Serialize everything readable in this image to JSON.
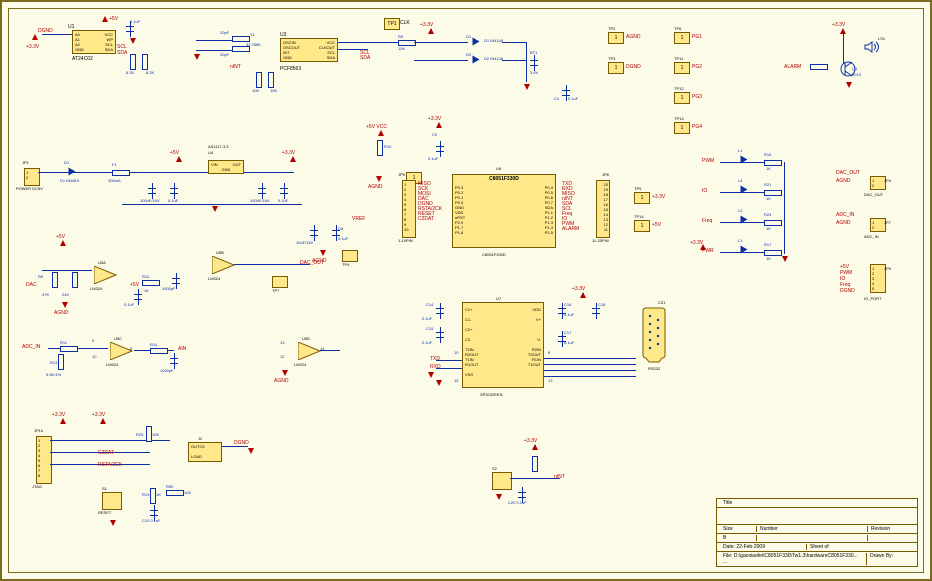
{
  "sheet": {
    "title_block": {
      "title_label": "Title",
      "title": "",
      "size_label": "Size",
      "size": "B",
      "number_label": "Number",
      "number": "",
      "rev_label": "Revision",
      "rev": "",
      "date_label": "Date:",
      "date": "22-Feb-2009",
      "sheet_label": "Sheet",
      "sheet": "of",
      "file_label": "File:",
      "file": "D:\\gaoxiaofei\\C8051F330\\Tw1.3\\hardwareC8051F330... ...",
      "drawn_label": "Drawn By:"
    }
  },
  "eeprom": {
    "ref": "U1",
    "part": "AT24C02",
    "pins": [
      "A0",
      "A1",
      "A2",
      "GND",
      "WP",
      "SCL",
      "SDA",
      "VCC"
    ],
    "pwr": "+5V",
    "gnd": "DGND",
    "nets": {
      "scl": "SCL",
      "sda": "SDA"
    },
    "decouple": {
      "ref": "C9",
      "val": "0.1uF"
    },
    "pullups": [
      {
        "ref": "R1",
        "val": "8.2K"
      },
      {
        "ref": "R2",
        "val": "8.2K"
      }
    ]
  },
  "rtc": {
    "ref": "U3",
    "part": "PCF8563",
    "pins_l": [
      "OSCIN",
      "OSCOUT",
      "INT",
      "GND"
    ],
    "pins_r": [
      "VCC",
      "CLKOUT",
      "SCL",
      "SDA"
    ],
    "crystal": {
      "ref": "Y1",
      "val": "32.768K",
      "c1": "20pF",
      "c2": "20pF"
    },
    "pullups": [
      {
        "ref": "R3",
        "val": "10K"
      },
      {
        "ref": "R4",
        "val": "10K"
      }
    ],
    "int_net": "nINT",
    "out": {
      "tp": "TP1",
      "net": "CLK",
      "r": "R5",
      "rv": "10K"
    },
    "pwr": "+3.3V",
    "diodes": [
      "D1 IN4148",
      "D2 IN4148"
    ],
    "bat": {
      "ref": "BT1",
      "val": "3.6V"
    },
    "cap": {
      "ref": "C4",
      "val": "0.1uF"
    }
  },
  "power_tp": [
    {
      "ref": "TP2",
      "net": "AGND"
    },
    {
      "ref": "TP3",
      "net": "DGND"
    }
  ],
  "scope_tp": [
    {
      "ref": "TP6",
      "net": "PG1"
    },
    {
      "ref": "TP11",
      "net": "PG2"
    },
    {
      "ref": "TP12",
      "net": "PG3"
    },
    {
      "ref": "TP13",
      "net": "PG4"
    }
  ],
  "buzzer": {
    "ref": "LS1",
    "q": "Q1 9013",
    "r1": "R30 1K",
    "net": "ALARM",
    "pwr": "+3.3V"
  },
  "power_in": {
    "conn": {
      "ref": "JP1",
      "label": "POWER DC5V",
      "pins": [
        "1",
        "2"
      ]
    },
    "diode": "D1 IN5819",
    "fuse": {
      "ref": "F1",
      "val": "300mA"
    },
    "reg": {
      "ref": "U4",
      "part": "AS1117-3.3",
      "pins": [
        "VIN",
        "OUT",
        "GND"
      ]
    },
    "caps": [
      {
        "ref": "C5",
        "val": "100uF/16V"
      },
      {
        "ref": "C6",
        "val": "0.1uF"
      },
      {
        "ref": "C7",
        "val": "100uF/16V"
      },
      {
        "ref": "C8",
        "val": "0.1uF"
      }
    ],
    "outs": [
      "+5V",
      "+3.3V"
    ]
  },
  "vref": {
    "net": "VREF",
    "r": "R10",
    "cap": {
      "ref": "C9",
      "val": "0.1uF"
    },
    "tp": "TP3?",
    "agnd": "AGND",
    "pwr": "+5V VCC"
  },
  "mcu": {
    "ref": "U6",
    "part": "C8051F330D",
    "subtitle": "C8051F330D",
    "left_header": "1-10PIN",
    "right_header": "11-20PIN",
    "pins_left": [
      {
        "n": "1",
        "net": "MISO",
        "pin": "P0.3"
      },
      {
        "n": "2",
        "net": "SCK",
        "pin": "P0.2"
      },
      {
        "n": "3",
        "net": "MOSI",
        "pin": "P0.1"
      },
      {
        "n": "4",
        "net": "DAC",
        "pin": "P0.0"
      },
      {
        "n": "5",
        "net": "DGND",
        "pin": "GND"
      },
      {
        "n": "6",
        "net": "RSTA/2CK",
        "pin": "VDD"
      },
      {
        "n": "7",
        "net": "RESET",
        "pin": "nRST"
      },
      {
        "n": "8",
        "net": "C2DAT",
        "pin": "P2.0"
      },
      {
        "n": "9",
        "net": "",
        "pin": "P1.7"
      },
      {
        "n": "10",
        "net": "",
        "pin": "P1.6"
      }
    ],
    "pins_right": [
      {
        "n": "20",
        "pin": "P0.4",
        "net": "TXD"
      },
      {
        "n": "19",
        "pin": "P0.5",
        "net": "RXD"
      },
      {
        "n": "18",
        "pin": "P0.6",
        "net": "MISO"
      },
      {
        "n": "17",
        "pin": "P0.7",
        "net": "nINT"
      },
      {
        "n": "16",
        "pin": "SDA",
        "net": "SDA"
      },
      {
        "n": "15",
        "pin": "P1.1",
        "net": "SCL"
      },
      {
        "n": "14",
        "pin": "P1.2",
        "net": "Freq"
      },
      {
        "n": "13",
        "pin": "P1.3",
        "net": "IO"
      },
      {
        "n": "12",
        "pin": "P1.4",
        "net": "PWM"
      },
      {
        "n": "11",
        "pin": "P1.5",
        "net": "ALARM"
      }
    ],
    "headers": {
      "left": "JP5",
      "right": "JP6"
    },
    "tp": [
      {
        "ref": "TP5",
        "net": "+3.3V"
      },
      {
        "ref": "TP14",
        "net": "+5V"
      }
    ]
  },
  "leds": [
    {
      "net": "PWM",
      "led": "L1",
      "r": "R15 1K"
    },
    {
      "net": "IO",
      "led": "L4",
      "r": "R21 1K"
    },
    {
      "net": "Freq",
      "led": "L2",
      "r": "R24 1K"
    },
    {
      "net": "PWR",
      "led": "L3",
      "r": "R17 1K"
    }
  ],
  "led_rail": "+3.3V",
  "io_ports": [
    {
      "ref": "JP4",
      "label": "DAC_OUT",
      "nets": [
        "AGND",
        "DAC_OUT"
      ],
      "pins": [
        "1",
        "2"
      ]
    },
    {
      "ref": "JP7",
      "label": "ADC_IN",
      "nets": [
        "AGND",
        "ADC_IN"
      ],
      "pins": [
        "1",
        "2"
      ]
    },
    {
      "ref": "JP9",
      "label": "IO_PORT",
      "nets": [
        "+5V",
        "PWM",
        "IO",
        "Freq",
        "DGND"
      ],
      "pins": [
        "1",
        "2",
        "3",
        "4",
        "5"
      ]
    }
  ],
  "analog_vref": {
    "net": "VREF",
    "cap": "C8 0.1uF",
    "cap2": "10uF/16V",
    "rail": "+3.3V",
    "tp": "TP4",
    "agnd": "AGND"
  },
  "dac_chain": {
    "u5a": {
      "ref": "U5A",
      "part": "LM324"
    },
    "u5b": {
      "ref": "U5B",
      "part": "LM324"
    },
    "in": "DAC",
    "out": "DAC_OUT",
    "r": [
      {
        "ref": "R6",
        "val": "47K"
      },
      {
        "ref": "R7",
        "val": "24K"
      },
      {
        "ref": "R12",
        "val": "1K"
      }
    ],
    "c": [
      {
        "ref": "C10",
        "val": "0.1uF"
      },
      {
        "ref": "C11",
        "val": "1000pF"
      }
    ],
    "rail": "+5V",
    "agnd": "AGND",
    "tp": "TP7"
  },
  "adc_chain": {
    "u5c": {
      "ref": "U5C",
      "part": "LM324"
    },
    "u5d": {
      "ref": "U5D",
      "part": "LM324"
    },
    "in": "ADC_IN",
    "out": "AIN",
    "r": [
      {
        "ref": "R11",
        "val": ""
      },
      {
        "ref": "R13",
        "val": "5.5K/1%"
      },
      {
        "ref": "R14",
        "val": ""
      },
      {
        "ref": "R15",
        "val": "1000pF"
      }
    ],
    "tie_out": "14"
  },
  "jtag": {
    "ref": "JP10",
    "label": "JTAG",
    "pins": [
      "1",
      "2",
      "3",
      "4",
      "5",
      "6",
      "7",
      "8"
    ],
    "nets": [
      "+3.3V",
      "",
      "C2DAT",
      "",
      "RSTA/2CK",
      "",
      "",
      ""
    ],
    "sw": "S1 RESET",
    "r": [
      {
        "ref": "R19",
        "val": "1K"
      },
      {
        "ref": "R25",
        "val": "10K"
      },
      {
        "ref": "R50",
        "val": "10K"
      }
    ],
    "cap": "C10 0.1uF",
    "block": {
      "ref": "J2",
      "pins": [
        "OUTC5",
        "LOAD"
      ]
    },
    "gnd": "DGND"
  },
  "rs232": {
    "ref": "U7",
    "part": "SP3232EEN",
    "pins_l": [
      "C1+",
      "C1-",
      "C2+",
      "C2-",
      "T2IN",
      "R2OUT",
      "T1IN",
      "R1OUT",
      "VSS"
    ],
    "pins_r": [
      "VDD",
      "V+",
      "V-",
      "R2IN",
      "T2OUT",
      "R1IN",
      "T1OUT"
    ],
    "caps": [
      {
        "ref": "C14",
        "val": "0.1uF"
      },
      {
        "ref": "C15",
        "val": "0.1uF"
      },
      {
        "ref": "C16",
        "val": "0.1uF"
      },
      {
        "ref": "C17",
        "val": "0.1uF"
      },
      {
        "ref": "C18",
        "val": ""
      }
    ],
    "pwr": "+3.3V",
    "nets": {
      "tx": "TXD",
      "rx": "RXD"
    },
    "conn": {
      "ref": "CZ1",
      "label": "RS232"
    }
  },
  "int_sw": {
    "ref": "S2",
    "net": "nINT",
    "pull": "R? 10K",
    "cap": "C20 0.1uF",
    "pwr": "+3.3V"
  }
}
